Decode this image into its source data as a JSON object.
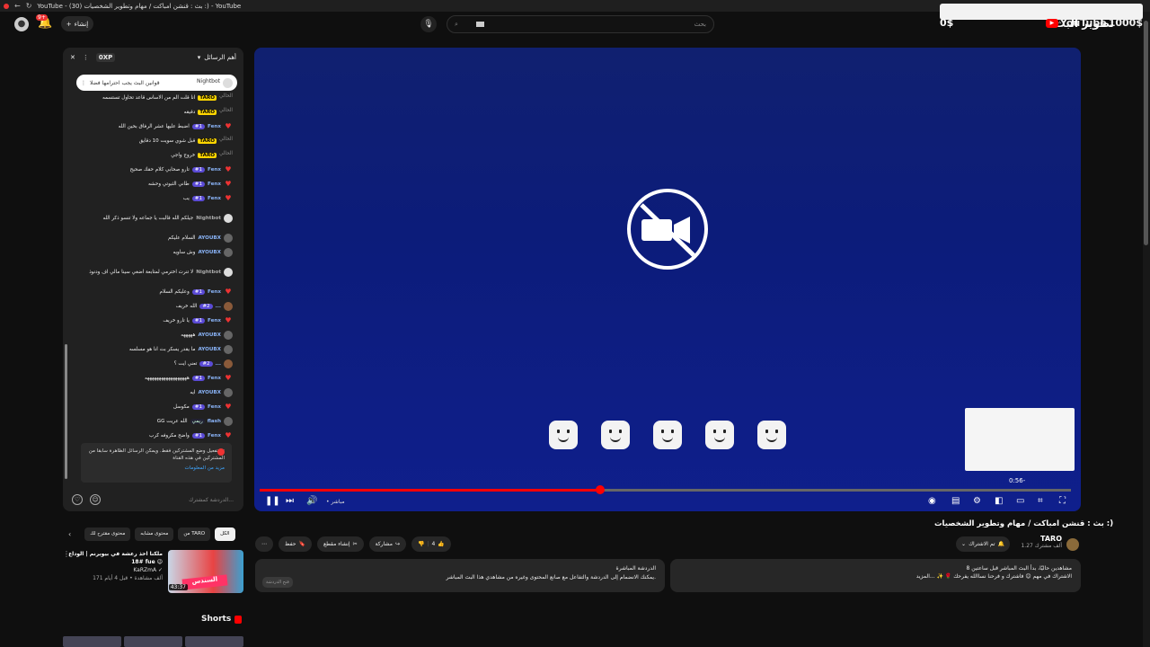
{
  "browser": {
    "tab_title": "YouTube - (30) بث : قنشن امباكت / مهام وتطوير الشخصيات :) - YouTube"
  },
  "header": {
    "create_label": "إنشاء",
    "notifications_count": "9+",
    "search_placeholder": "بحث",
    "earnings": "0$",
    "channel_title": "تطوير البث",
    "logo_text": "YouTube",
    "logo_suffix": "1000$"
  },
  "chat": {
    "xp": "0XP",
    "title": "أهم الرسائل",
    "pinned_author": "Nightbot",
    "pinned_text": "قوانين البث يجب احترامها فضلا",
    "messages": [
      {
        "author": "TARO",
        "badge": "TARO",
        "text": "انا قلت الم من الاساس قاعد تحاول تستسمه",
        "avatar": "time",
        "time": "الحالي"
      },
      {
        "author": "TARO",
        "badge": "TARO",
        "text": "دقيقه",
        "avatar": "time",
        "time": "الحالي"
      },
      {
        "author": "Fenx",
        "tag": "#1",
        "text": "اضبط عليها عشر الرفاق بحين الله",
        "avatar": "heart"
      },
      {
        "author": "TARO",
        "badge": "TARO",
        "text": "قبل شوي سويت 10 دقايق",
        "avatar": "time",
        "time": "الحالي"
      },
      {
        "author": "TARO",
        "badge": "TARO",
        "text": "خروج واجي",
        "avatar": "time",
        "time": "الحالي"
      },
      {
        "author": "Fenx",
        "tag": "#1",
        "text": "تارو صحابي كلام حقك صحيح",
        "avatar": "heart"
      },
      {
        "author": "Fenx",
        "tag": "#1",
        "text": "طاني الثبوتي وحشه",
        "avatar": "heart"
      },
      {
        "author": "Fenx",
        "tag": "#1",
        "text": "يب",
        "avatar": "heart"
      },
      {
        "author": "Nightbot",
        "text": "جيلكم الله قالبت يا جماعه ولا تنسو ذكر الله",
        "avatar": "bot",
        "tall": true
      },
      {
        "author": "AYOUBX",
        "text": "السلام عليكم",
        "avatar": "grey"
      },
      {
        "author": "AYOUBX",
        "text": "وش ساويه",
        "avatar": "grey"
      },
      {
        "author": "Nightbot",
        "text": "لا تنرت اخترمي لمتابعة اضغي سينا مالي اف ودنوذ",
        "avatar": "bot",
        "tall": true
      },
      {
        "author": "Fenx",
        "tag": "#1",
        "text": "وعليكم السلام",
        "avatar": "heart"
      },
      {
        "author": "...",
        "tag": "#2",
        "text": "الله خريف",
        "avatar": "brown"
      },
      {
        "author": "Fenx",
        "tag": "#1",
        "text": "يا تارو خريف",
        "avatar": "heart"
      },
      {
        "author": "AYOUBX",
        "text": "هههههه",
        "avatar": "grey"
      },
      {
        "author": "AYOUBX",
        "text": "ما يقدر يسكر بث انا هو مسلسه",
        "avatar": "grey"
      },
      {
        "author": "...",
        "tag": "#2",
        "text": "تعني ايت ؟",
        "avatar": "brown"
      },
      {
        "author": "Fenx",
        "tag": "#1",
        "text": "ههههههههههههههههههه",
        "avatar": "heart"
      },
      {
        "author": "AYOUBX",
        "text": "ايه",
        "avatar": "grey"
      },
      {
        "author": "Fenx",
        "tag": "#1",
        "text": "مكوسل",
        "avatar": "heart"
      },
      {
        "author": "flash",
        "tag2": "ريمي",
        "text": "GG الله عريت",
        "avatar": "grey"
      },
      {
        "author": "Fenx",
        "tag": "#1",
        "text": "واضح مكروفه كرب",
        "avatar": "heart"
      }
    ],
    "notice": "تم تفعيل وضع المشتركين فقط. ويمكن الرسائل الظاهرة سابقا من المشتركين في هذه القناة",
    "notice_link": "مزيد من المعلومات",
    "input_placeholder": "الدردشة كمشترك..."
  },
  "player": {
    "preview_time": "0:56-",
    "live_label": "• مباشر",
    "progress_fraction": 0.42
  },
  "video": {
    "title": "بث : قنشن امباكت / مهام وتطوير الشخصيات :)",
    "owner": "TARO",
    "subscribers": "1.27 ألف مشترك",
    "subscribe_label": "تم الاشتراك",
    "likes": "4",
    "share_label": "مشاركة",
    "clip_label": "إنشاء مقطع",
    "save_label": "حفظ",
    "desc_line1": "8 مشاهدين حاليًا، بدأ البث المباشر قبل ساعتين",
    "desc_line2": "الاشتراك في مهم 😊 فاشترك و فرحنا نساالله يفرحك 🌹 ✨ ...المزيد",
    "chat_replay_title": "الدردشة المباشرة",
    "chat_replay_text": "يمكنك الانضمام إلى الدردشة والتفاعل مع صانع المحتوى وغيره من مشاهدي هذا البث المباشر.",
    "chat_replay_chip": "فتح الدردشة"
  },
  "related": {
    "chips": [
      "الكل",
      "من TARO",
      "محتوى مشابه",
      "محتوى مقترح لك"
    ],
    "item_title": "ملكنا اخذ رعشة في بيوبرنم | الوداع #18 fue 😉",
    "item_channel": "KaRZmA ✓",
    "item_meta": "171 ألف مشاهدة • قبل 4 أيام",
    "item_duration": "43:37",
    "item_thumb_text": "السندس",
    "shorts_label": "Shorts"
  }
}
